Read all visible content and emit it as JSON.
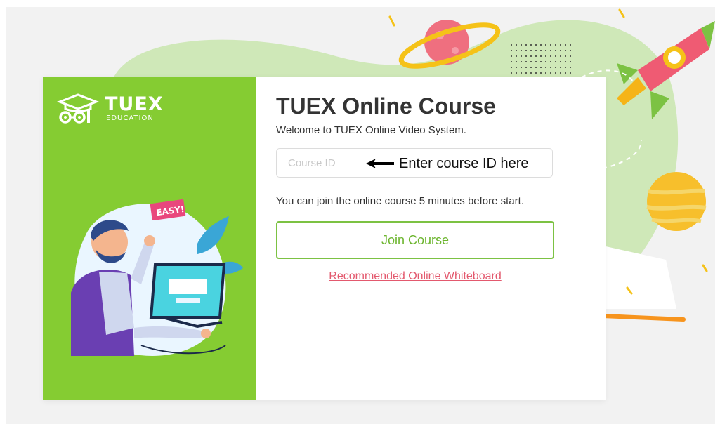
{
  "brand": {
    "wordmark": "TUEX",
    "subtitle": "EDUCATION"
  },
  "illustration": {
    "badge_text": "EASY!"
  },
  "login": {
    "title": "TUEX Online Course",
    "welcome": "Welcome to TUEX Online Video System.",
    "course_id_placeholder": "Course ID",
    "course_id_value": "",
    "hint": "Enter course ID here",
    "join_info": "You can join the online course 5 minutes before start.",
    "join_button": "Join Course",
    "whiteboard_link": "Recommended Online Whiteboard"
  },
  "colors": {
    "brand_green": "#85cc32",
    "button_green": "#7cc243",
    "link_pink": "#e3596e",
    "page_bg": "#f2f2f2"
  }
}
